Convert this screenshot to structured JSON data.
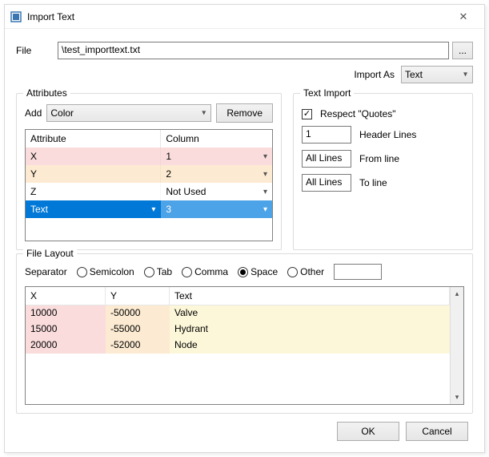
{
  "window": {
    "title": "Import Text"
  },
  "file": {
    "label": "File",
    "value": "\\test_importtext.txt",
    "browse": "..."
  },
  "importAs": {
    "label": "Import As",
    "value": "Text"
  },
  "attributes": {
    "legend": "Attributes",
    "addLabel": "Add",
    "addValue": "Color",
    "removeLabel": "Remove",
    "headers": {
      "attribute": "Attribute",
      "column": "Column"
    },
    "rows": [
      {
        "attr": "X",
        "col": "1",
        "tone": "pink"
      },
      {
        "attr": "Y",
        "col": "2",
        "tone": "peach"
      },
      {
        "attr": "Z",
        "col": "Not Used",
        "tone": "white"
      },
      {
        "attr": "Text",
        "col": "3",
        "tone": "sel"
      }
    ]
  },
  "textImport": {
    "legend": "Text Import",
    "respectQuotes": {
      "label": "Respect \"Quotes\"",
      "checked": true
    },
    "headerLines": {
      "value": "1",
      "label": "Header Lines"
    },
    "fromLine": {
      "value": "All Lines",
      "label": "From line"
    },
    "toLine": {
      "value": "All Lines",
      "label": "To line"
    }
  },
  "fileLayout": {
    "legend": "File Layout",
    "separatorLabel": "Separator",
    "options": {
      "semicolon": "Semicolon",
      "tab": "Tab",
      "comma": "Comma",
      "space": "Space",
      "other": "Other"
    },
    "selected": "space",
    "otherValue": "",
    "headers": {
      "x": "X",
      "y": "Y",
      "text": "Text"
    },
    "rows": [
      {
        "x": "10000",
        "y": "-50000",
        "text": "Valve"
      },
      {
        "x": "15000",
        "y": "-55000",
        "text": "Hydrant"
      },
      {
        "x": "20000",
        "y": "-52000",
        "text": "Node"
      }
    ]
  },
  "buttons": {
    "ok": "OK",
    "cancel": "Cancel"
  }
}
